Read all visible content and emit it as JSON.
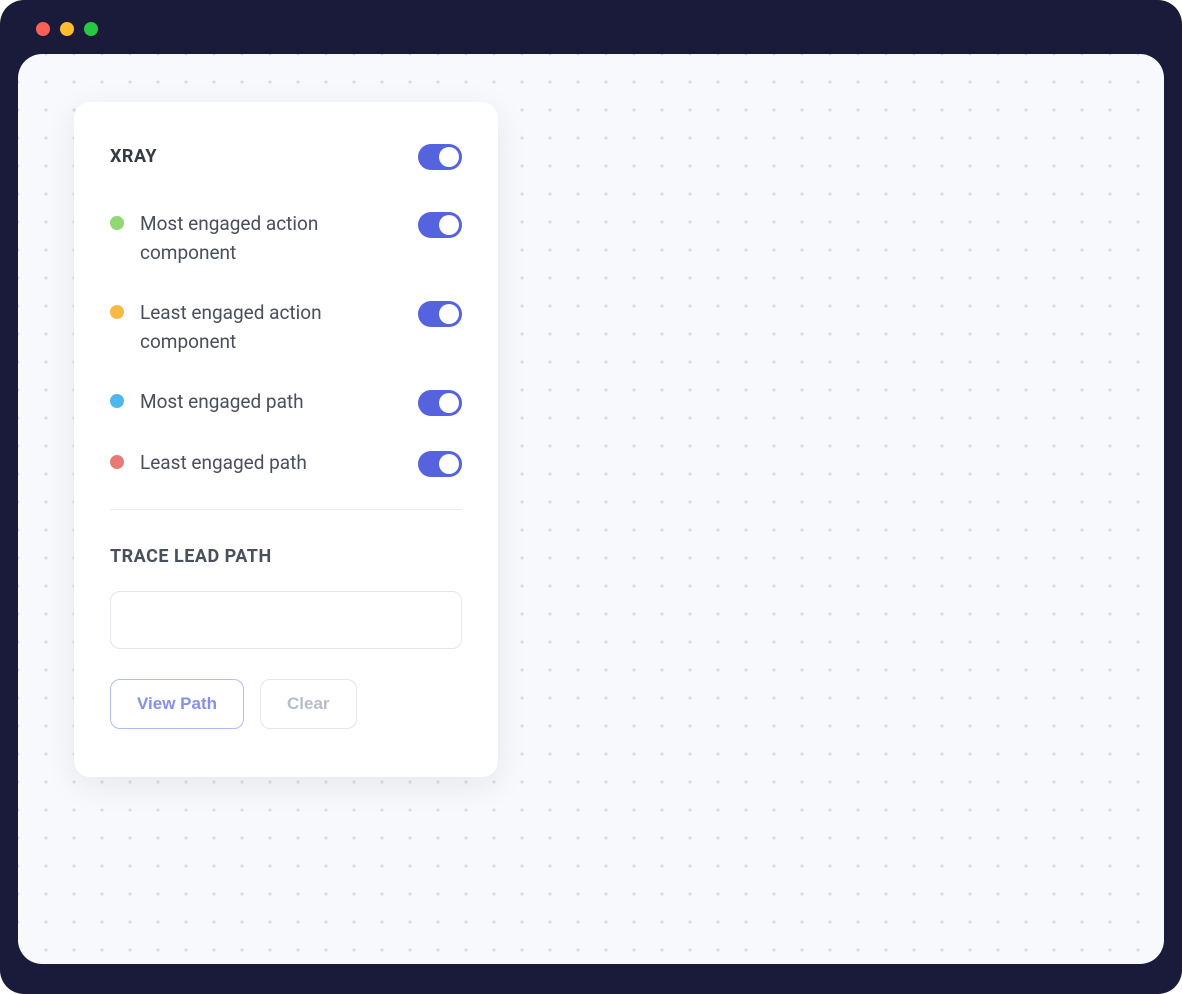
{
  "window": {
    "traffic_lights": [
      "red",
      "yellow",
      "green"
    ]
  },
  "panel": {
    "title": "XRAY",
    "master_toggle_on": true,
    "toggles": [
      {
        "label": "Most engaged action component",
        "dot_color": "#8fd974",
        "on": true
      },
      {
        "label": "Least engaged action component",
        "dot_color": "#f5b946",
        "on": true
      },
      {
        "label": "Most engaged path",
        "dot_color": "#4fb7f0",
        "on": true
      },
      {
        "label": "Least engaged path",
        "dot_color": "#e77a74",
        "on": true
      }
    ],
    "trace": {
      "title": "TRACE LEAD PATH",
      "input_value": "",
      "view_path_label": "View Path",
      "clear_label": "Clear"
    }
  },
  "colors": {
    "window_bg": "#1a1a3a",
    "viewport_bg": "#f7f9fc",
    "toggle_on": "#5563de",
    "primary_button_border": "#b3bdf2",
    "primary_button_text": "#8591e8"
  }
}
